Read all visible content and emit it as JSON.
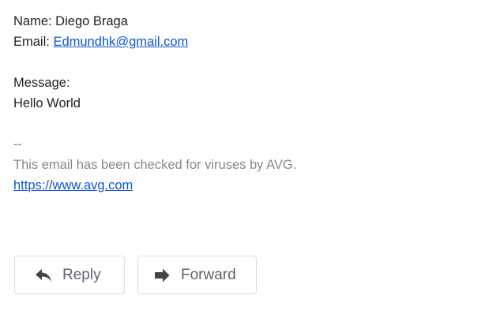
{
  "message": {
    "name_line": "Name: Diego Braga",
    "email_prefix": "Email: ",
    "email_link": "Edmundhk@gmail.com",
    "message_label": "Message:",
    "message_text": "Hello World"
  },
  "signature": {
    "separator": "--",
    "text": "This email has been checked for viruses by AVG.",
    "link": "https://www.avg.com"
  },
  "actions": {
    "reply_label": "Reply",
    "reply_icon": "reply-arrow-icon",
    "forward_label": "Forward",
    "forward_icon": "forward-arrow-icon"
  },
  "colors": {
    "link": "#1155cc",
    "signature_text": "#888888",
    "button_text": "#5f6368",
    "button_border": "#dadce0"
  }
}
